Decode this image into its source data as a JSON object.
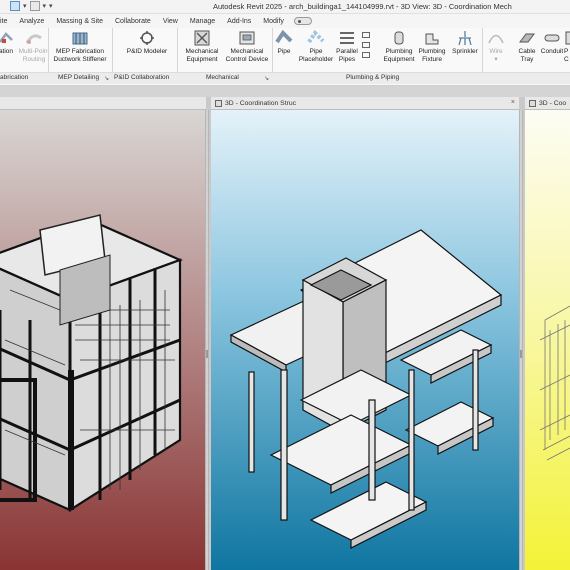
{
  "window": {
    "title": "Autodesk Revit 2025 - arch_buildinga1_144104999.rvt - 3D View: 3D - Coordination Mech"
  },
  "quick_access": [
    "grid-icon",
    "save-icon",
    "undo-icon",
    "dropdown-icon"
  ],
  "ribbon_tabs": [
    "ite",
    "Analyze",
    "Massing & Site",
    "Collaborate",
    "View",
    "Manage",
    "Add-Ins",
    "Modify"
  ],
  "ribbon_tools": [
    {
      "label1": "ation",
      "label2": "",
      "icon": "fabrication-part-icon",
      "dim": false
    },
    {
      "label1": "Multi-Point",
      "label2": "Routing",
      "icon": "multipoint-routing-icon",
      "dim": true
    },
    {
      "label1": "MEP Fabrication",
      "label2": "Ductwork Stiffener",
      "icon": "duct-stiffener-icon",
      "dim": false
    },
    {
      "label1": "P&ID Modeler",
      "label2": "",
      "icon": "pid-modeler-icon",
      "dim": false
    },
    {
      "label1": "Mechanical",
      "label2": "Equipment",
      "icon": "mechanical-equipment-icon",
      "dim": false
    },
    {
      "label1": "Mechanical",
      "label2": "Control Device",
      "icon": "control-device-icon",
      "dim": false
    },
    {
      "label1": "Pipe",
      "label2": "",
      "icon": "pipe-icon",
      "dim": false
    },
    {
      "label1": "Pipe",
      "label2": "Placeholder",
      "icon": "pipe-placeholder-icon",
      "dim": false
    },
    {
      "label1": "Parallel",
      "label2": "Pipes",
      "icon": "parallel-pipes-icon",
      "dim": false
    },
    {
      "label1": "Plumbing",
      "label2": "Equipment",
      "icon": "plumbing-equipment-icon",
      "dim": false
    },
    {
      "label1": "Plumbing",
      "label2": "Fixture",
      "icon": "plumbing-fixture-icon",
      "dim": false
    },
    {
      "label1": "Sprinkler",
      "label2": "",
      "icon": "sprinkler-icon",
      "dim": false
    },
    {
      "label1": "Wire",
      "label2": "",
      "icon": "wire-icon",
      "dim": true
    },
    {
      "label1": "Cable",
      "label2": "Tray",
      "icon": "cable-tray-icon",
      "dim": false
    },
    {
      "label1": "Conduit",
      "label2": "",
      "icon": "conduit-icon",
      "dim": false
    },
    {
      "label1": "P",
      "label2": "C",
      "icon": "parallel-conduits-icon",
      "dim": false
    }
  ],
  "panel_labels": [
    "abrication",
    "MEP Detailing",
    "P&ID Collaboration",
    "Mechanical",
    "Plumbing & Piping"
  ],
  "views": [
    {
      "tab": "",
      "background": [
        "#d9d6d4",
        "#8a3434"
      ]
    },
    {
      "tab": "3D - Coordination Struc",
      "background": [
        "#dceef7",
        "#1a7fa8"
      ]
    },
    {
      "tab": "3D - Coo",
      "background": [
        "#fdfcf0",
        "#f4f23a"
      ]
    }
  ]
}
